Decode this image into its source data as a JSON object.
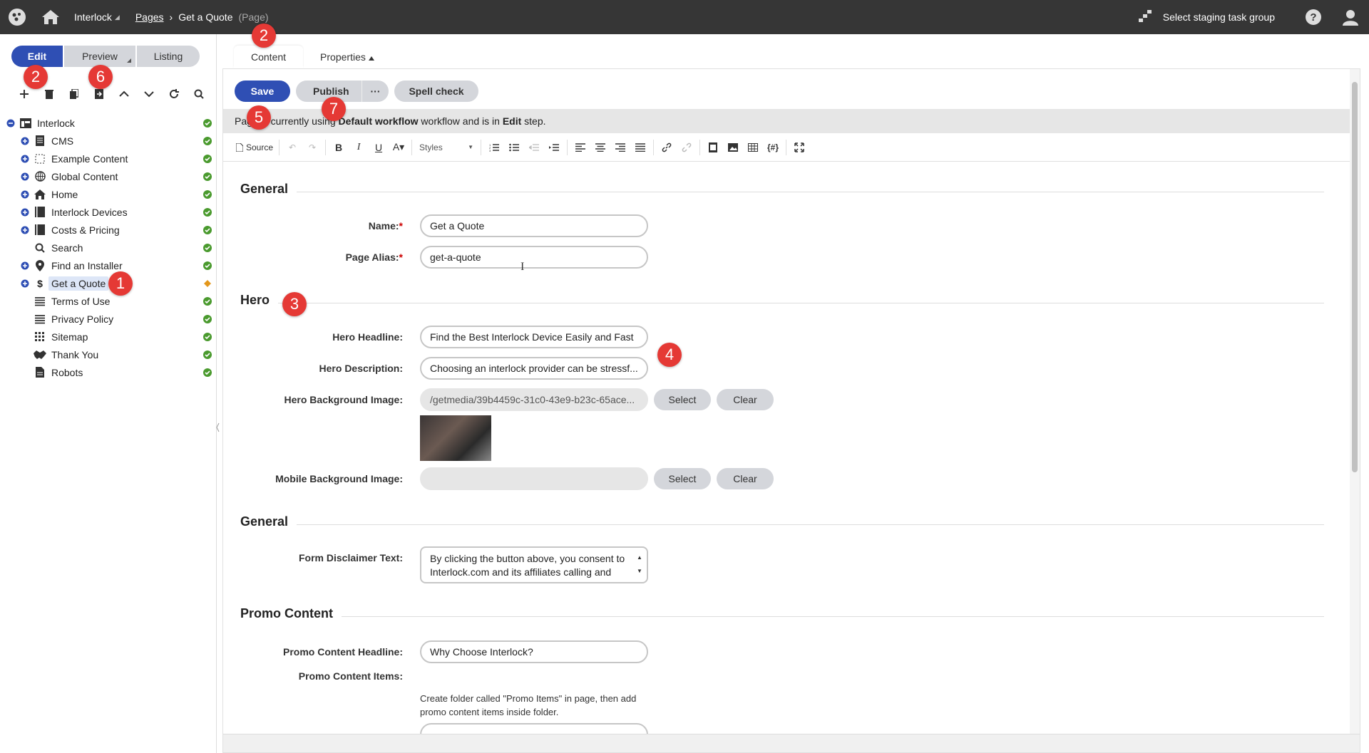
{
  "topbar": {
    "site_name": "Interlock",
    "breadcrumb_link": "Pages",
    "breadcrumb_current": "Get a Quote",
    "breadcrumb_type": "(Page)",
    "staging_label": "Select staging task group"
  },
  "mode_tabs": {
    "edit": "Edit",
    "preview": "Preview",
    "listing": "Listing"
  },
  "tree": [
    {
      "label": "Interlock",
      "icon": "page-layout-icon",
      "status": "published"
    },
    {
      "label": "CMS",
      "icon": "document-icon",
      "status": "published"
    },
    {
      "label": "Example Content",
      "icon": "dashed-square-icon",
      "status": "published"
    },
    {
      "label": "Global Content",
      "icon": "globe-icon",
      "status": "published"
    },
    {
      "label": "Home",
      "icon": "home-icon",
      "status": "published"
    },
    {
      "label": "Interlock Devices",
      "icon": "book-icon",
      "status": "published"
    },
    {
      "label": "Costs & Pricing",
      "icon": "book-icon",
      "status": "published"
    },
    {
      "label": "Search",
      "icon": "search-icon",
      "status": "published"
    },
    {
      "label": "Find an Installer",
      "icon": "map-pin-icon",
      "status": "published"
    },
    {
      "label": "Get a Quote",
      "icon": "dollar-icon",
      "status": "edited"
    },
    {
      "label": "Terms of Use",
      "icon": "lines-icon",
      "status": "published"
    },
    {
      "label": "Privacy Policy",
      "icon": "lines-icon",
      "status": "published"
    },
    {
      "label": "Sitemap",
      "icon": "grid-icon",
      "status": "published"
    },
    {
      "label": "Thank You",
      "icon": "handshake-icon",
      "status": "published"
    },
    {
      "label": "Robots",
      "icon": "file-icon",
      "status": "published"
    }
  ],
  "content_tabs": {
    "content": "Content",
    "properties": "Properties"
  },
  "actions": {
    "save": "Save",
    "publish": "Publish",
    "more": "···",
    "spell": "Spell check"
  },
  "workflow": {
    "prefix": "Page is currently using ",
    "workflow_name": "Default workflow",
    "middle": " workflow and is in ",
    "step": "Edit",
    "suffix": " step."
  },
  "editor": {
    "source": "Source",
    "styles": "Styles"
  },
  "sections": {
    "general1": "General",
    "hero": "Hero",
    "general2": "General",
    "promo": "Promo Content"
  },
  "fields": {
    "name_label": "Name:",
    "name_value": "Get a Quote",
    "alias_label": "Page Alias:",
    "alias_value": "get-a-quote",
    "hero_headline_label": "Hero Headline:",
    "hero_headline_value": "Find the Best Interlock Device Easily and Fast",
    "hero_desc_label": "Hero Description:",
    "hero_desc_value": "Choosing an interlock provider can be stressf...",
    "hero_bg_label": "Hero Background Image:",
    "hero_bg_value": "/getmedia/39b4459c-31c0-43e9-b23c-65ace...",
    "mobile_bg_label": "Mobile Background Image:",
    "mobile_bg_value": "",
    "select": "Select",
    "clear": "Clear",
    "disclaimer_label": "Form Disclaimer Text:",
    "disclaimer_value": "By clicking the button above, you consent to Interlock.com and its affiliates calling and",
    "promo_headline_label": "Promo Content Headline:",
    "promo_headline_value": "Why Choose Interlock?",
    "promo_items_label": "Promo Content Items:",
    "promo_items_hint": "Create folder called \"Promo Items\" in page, then add promo content items inside folder."
  },
  "callouts": [
    "1",
    "2",
    "2",
    "3",
    "4",
    "5",
    "6",
    "7"
  ],
  "colors": {
    "primary": "#2f4fb4",
    "topbar": "#363636",
    "published": "#4a9a2e",
    "edited": "#e3971c",
    "callout": "#e53935"
  }
}
